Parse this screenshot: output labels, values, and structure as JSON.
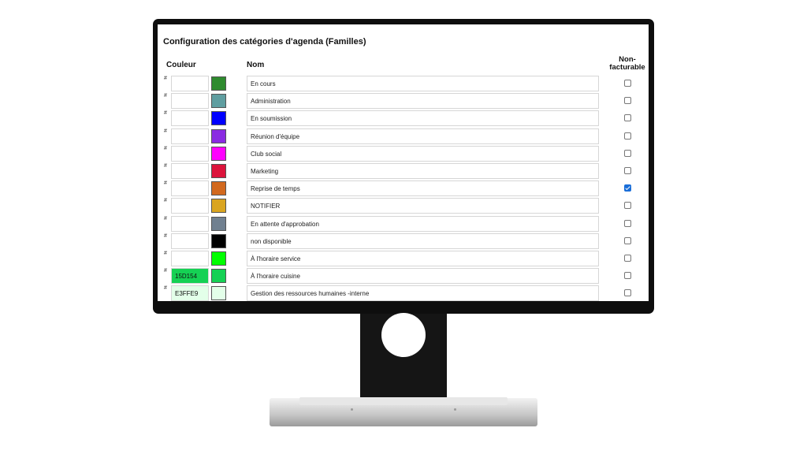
{
  "page": {
    "title": "Configuration des catégories d'agenda (Familles)",
    "headers": {
      "color": "Couleur",
      "name": "Nom",
      "nonbillable_line1": "Non-",
      "nonbillable_line2": "facturable"
    },
    "hash_symbol": "#"
  },
  "rows": [
    {
      "hex": "",
      "color": "#2e8b2e",
      "name": "En cours",
      "nonbillable": false
    },
    {
      "hex": "",
      "color": "#5f9ea0",
      "name": "Administration",
      "nonbillable": false
    },
    {
      "hex": "",
      "color": "#0000ff",
      "name": "En soumission",
      "nonbillable": false
    },
    {
      "hex": "",
      "color": "#8a2be2",
      "name": "Réunion d'équipe",
      "nonbillable": false
    },
    {
      "hex": "",
      "color": "#ff00ff",
      "name": "Club social",
      "nonbillable": false
    },
    {
      "hex": "",
      "color": "#dc143c",
      "name": "Marketing",
      "nonbillable": false
    },
    {
      "hex": "",
      "color": "#d2691e",
      "name": "Reprise de temps",
      "nonbillable": true
    },
    {
      "hex": "",
      "color": "#daa520",
      "name": "NOTIFIER",
      "nonbillable": false
    },
    {
      "hex": "",
      "color": "#708090",
      "name": "En attente d'approbation",
      "nonbillable": false
    },
    {
      "hex": "",
      "color": "#000000",
      "name": "non disponible",
      "nonbillable": false
    },
    {
      "hex": "",
      "color": "#00ff00",
      "name": "À l'horaire service",
      "nonbillable": false
    },
    {
      "hex": "15D154",
      "color": "#15d154",
      "name": "À l'horaire cuisine",
      "nonbillable": false
    },
    {
      "hex": "E3FFE9",
      "color": "#e3ffe9",
      "name": "Gestion des ressources humaines -interne",
      "nonbillable": false
    }
  ]
}
